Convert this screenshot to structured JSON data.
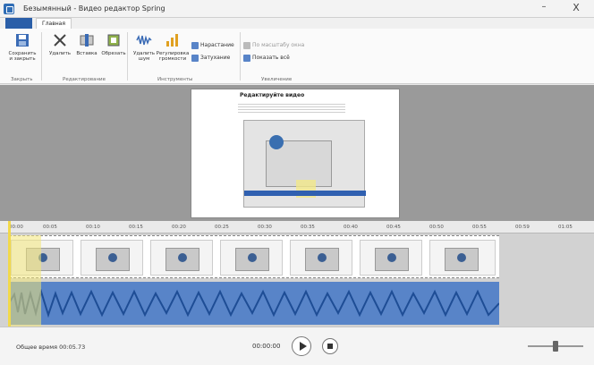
{
  "window": {
    "title": "Безымянный - Видео редактор Spring",
    "minimize_label": "–",
    "close_label": "X"
  },
  "ribbon_tabs": {
    "file_label": "",
    "home_label": "Главная"
  },
  "ribbon": {
    "buttons": [
      {
        "label": "Сохранить и закрыть",
        "icon": "save-icon"
      },
      {
        "label": "Удалить",
        "icon": "cut-icon"
      },
      {
        "label": "Вставка",
        "icon": "insert-icon"
      },
      {
        "label": "Обрезать",
        "icon": "crop-icon"
      },
      {
        "label": "Удалить шум",
        "icon": "noise-icon"
      },
      {
        "label": "Регулировка громкости",
        "icon": "volume-icon"
      }
    ],
    "small_buttons": [
      {
        "label": "Нарастание",
        "icon": "fade-in-icon"
      },
      {
        "label": "Затухание",
        "icon": "fade-out-icon"
      },
      {
        "label": "По масштабу окна",
        "icon": "fit-icon"
      },
      {
        "label": "Показать всё",
        "icon": "show-all-icon"
      }
    ],
    "groups": [
      "Закрыть",
      "Редактирование",
      "Инструменты",
      "Увеличение"
    ]
  },
  "preview": {
    "heading": "Редактируйте видео"
  },
  "timeline": {
    "ticks": [
      "00:00",
      "00:05",
      "00:10",
      "00:15",
      "00:20",
      "00:25",
      "00:30",
      "00:35",
      "00:40",
      "00:45",
      "00:50",
      "00:55",
      "00:59",
      "01:05"
    ]
  },
  "status": {
    "total_label": "Общее время 00:05.73",
    "current_time": "00:00:00"
  },
  "colors": {
    "accent": "#2a5ea8",
    "audio": "#5884c8",
    "playhead": "#f2d94a"
  }
}
